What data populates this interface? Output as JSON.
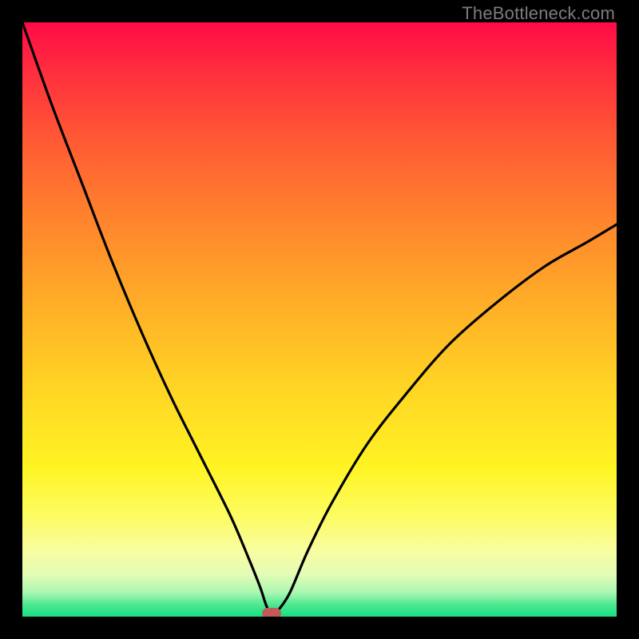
{
  "watermark": "TheBottleneck.com",
  "colors": {
    "frame": "#000000",
    "curve": "#000000",
    "marker": "#c25a5a",
    "watermark_text": "#7c7c7c"
  },
  "chart_data": {
    "type": "line",
    "title": "",
    "xlabel": "",
    "ylabel": "",
    "xlim": [
      0,
      100
    ],
    "ylim": [
      0,
      100
    ],
    "x": [
      0,
      5,
      10,
      15,
      20,
      25,
      30,
      35,
      38,
      40,
      41,
      42,
      43,
      45,
      48,
      52,
      58,
      65,
      72,
      80,
      88,
      95,
      100
    ],
    "values": [
      100,
      86,
      73,
      60,
      48,
      37,
      27,
      17,
      10,
      5,
      2,
      0,
      1,
      4,
      11,
      19,
      29,
      38,
      46,
      53,
      59,
      63,
      66
    ],
    "marker": {
      "x": 42,
      "y": 0
    },
    "grid": false,
    "legend": false
  }
}
